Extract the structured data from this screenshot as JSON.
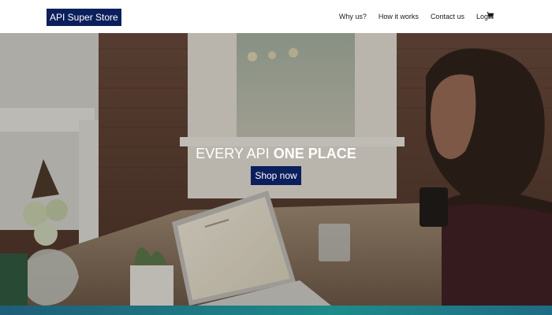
{
  "header": {
    "logo_text": "API Super Store",
    "nav_items": [
      {
        "label": "Why us?"
      },
      {
        "label": "How it works"
      },
      {
        "label": "Contact us"
      },
      {
        "label": "Login"
      }
    ],
    "cart_icon": "shopping-cart-icon"
  },
  "hero": {
    "title_part1": "EVERY API ",
    "title_part2": "ONE PLACE",
    "cta_label": "Shop now",
    "image": "photo: man working on laptop at wooden table"
  },
  "colors": {
    "brand_navy": "#0a1f5c",
    "footer_teal": "#1d8b8a"
  }
}
